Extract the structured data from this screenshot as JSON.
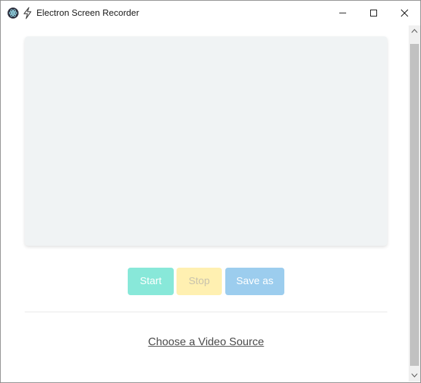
{
  "window": {
    "title": "Electron Screen Recorder",
    "app_icon": "electron-logo-icon",
    "bolt_icon": "lightning-bolt-icon",
    "controls": {
      "minimize_icon": "minimize-icon",
      "maximize_icon": "maximize-icon",
      "close_icon": "close-icon"
    }
  },
  "recorder": {
    "buttons": {
      "start_label": "Start",
      "stop_label": "Stop",
      "save_label": "Save as"
    },
    "source_link": "Choose a Video Source"
  },
  "colors": {
    "start_button": "#88e8d9",
    "stop_button": "#fff0b1",
    "save_button": "#9ccdee",
    "preview_background": "#f0f3f4"
  }
}
